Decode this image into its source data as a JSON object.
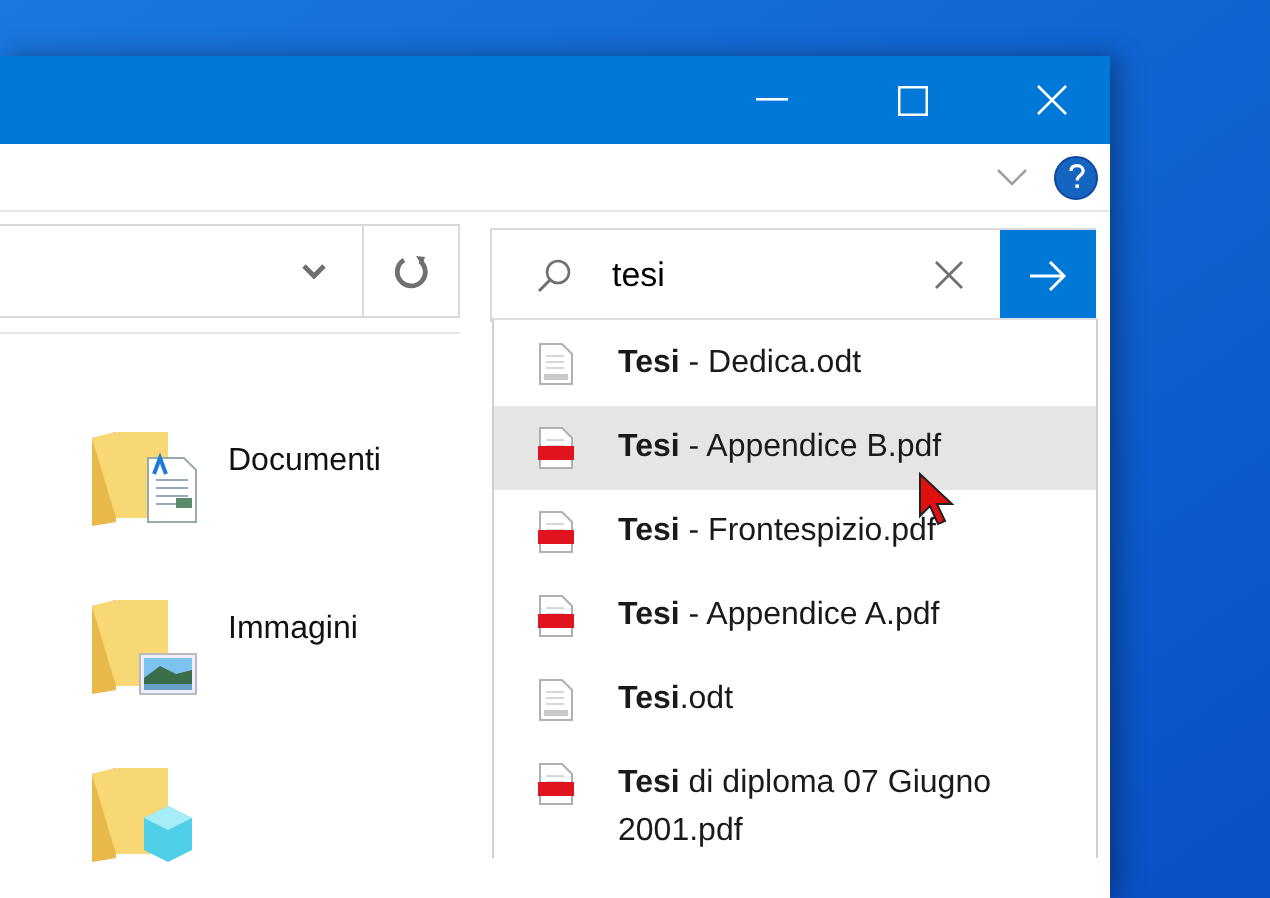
{
  "search": {
    "value": "tesi"
  },
  "suggestions": [
    {
      "name": "**Tesi** - Dedica.odt",
      "kind": "odt",
      "selected": false
    },
    {
      "name": "**Tesi** - Appendice B.pdf",
      "kind": "pdf",
      "selected": true
    },
    {
      "name": "**Tesi** - Frontespizio.pdf",
      "kind": "pdf",
      "selected": false
    },
    {
      "name": "**Tesi** - Appendice A.pdf",
      "kind": "pdf",
      "selected": false
    },
    {
      "name": "**Tesi**.odt",
      "kind": "odt",
      "selected": false
    },
    {
      "name": "**Tesi** di diploma 07 Giugno 2001.pdf",
      "kind": "pdf",
      "selected": false
    }
  ],
  "folders": [
    {
      "name": "Documenti",
      "kind": "documents"
    },
    {
      "name": "Immagini",
      "kind": "pictures"
    },
    {
      "kind": "objects3d"
    }
  ]
}
